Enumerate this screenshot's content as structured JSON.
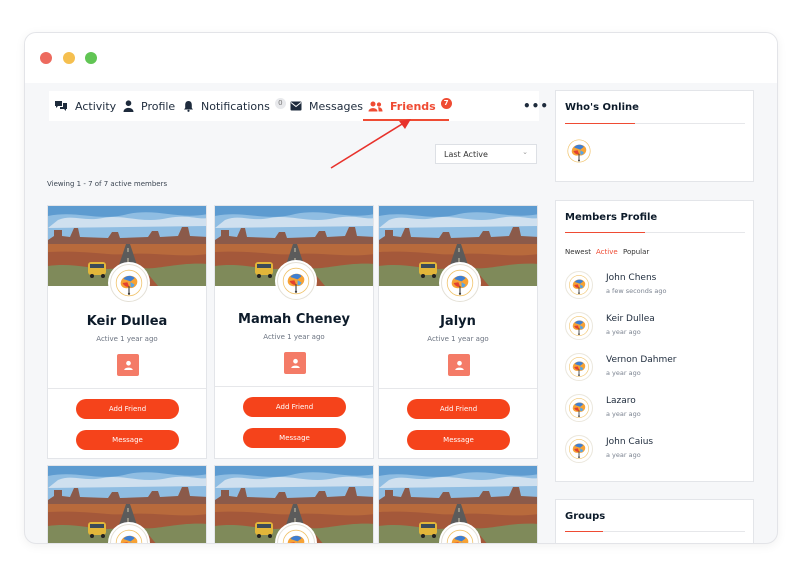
{
  "window": {
    "controls": [
      "close",
      "minimize",
      "maximize"
    ],
    "colors": {
      "close": "#ed6a5e",
      "minimize": "#f5bf4f",
      "maximize": "#61c554"
    }
  },
  "nav": {
    "tabs": [
      {
        "label": "Activity",
        "icon": "activity-icon"
      },
      {
        "label": "Profile",
        "icon": "profile-icon"
      },
      {
        "label": "Notifications",
        "icon": "bell-icon",
        "count": "0"
      },
      {
        "label": "Messages",
        "icon": "envelope-icon"
      },
      {
        "label": "Friends",
        "icon": "friends-icon",
        "count": "7",
        "active": true
      }
    ],
    "more_label": "•••",
    "accent_color": "#ef4b33"
  },
  "members": {
    "sort_selected": "Last Active",
    "viewing_text": "Viewing 1 - 7 of 7 active members",
    "cards": [
      {
        "name": "Keir Dullea",
        "active": "Active 1 year ago",
        "add_label": "Add Friend",
        "message_label": "Message"
      },
      {
        "name": "Mamah Cheney",
        "active": "Active 1 year ago",
        "add_label": "Add Friend",
        "message_label": "Message"
      },
      {
        "name": "Jalyn",
        "active": "Active 1 year ago",
        "add_label": "Add Friend",
        "message_label": "Message"
      }
    ],
    "button_color": "#f5431b"
  },
  "sidebar": {
    "whos_online": {
      "title": "Who's Online"
    },
    "members_profile": {
      "title": "Members Profile",
      "filters": [
        "Newest",
        "Active",
        "Popular"
      ],
      "active_filter": "Active",
      "list": [
        {
          "name": "John Chens",
          "time": "a few seconds ago"
        },
        {
          "name": "Keir Dullea",
          "time": "a year ago"
        },
        {
          "name": "Vernon Dahmer",
          "time": "a year ago"
        },
        {
          "name": "Lazaro",
          "time": "a year ago"
        },
        {
          "name": "John Caius",
          "time": "a year ago"
        }
      ]
    },
    "groups": {
      "title": "Groups"
    }
  }
}
